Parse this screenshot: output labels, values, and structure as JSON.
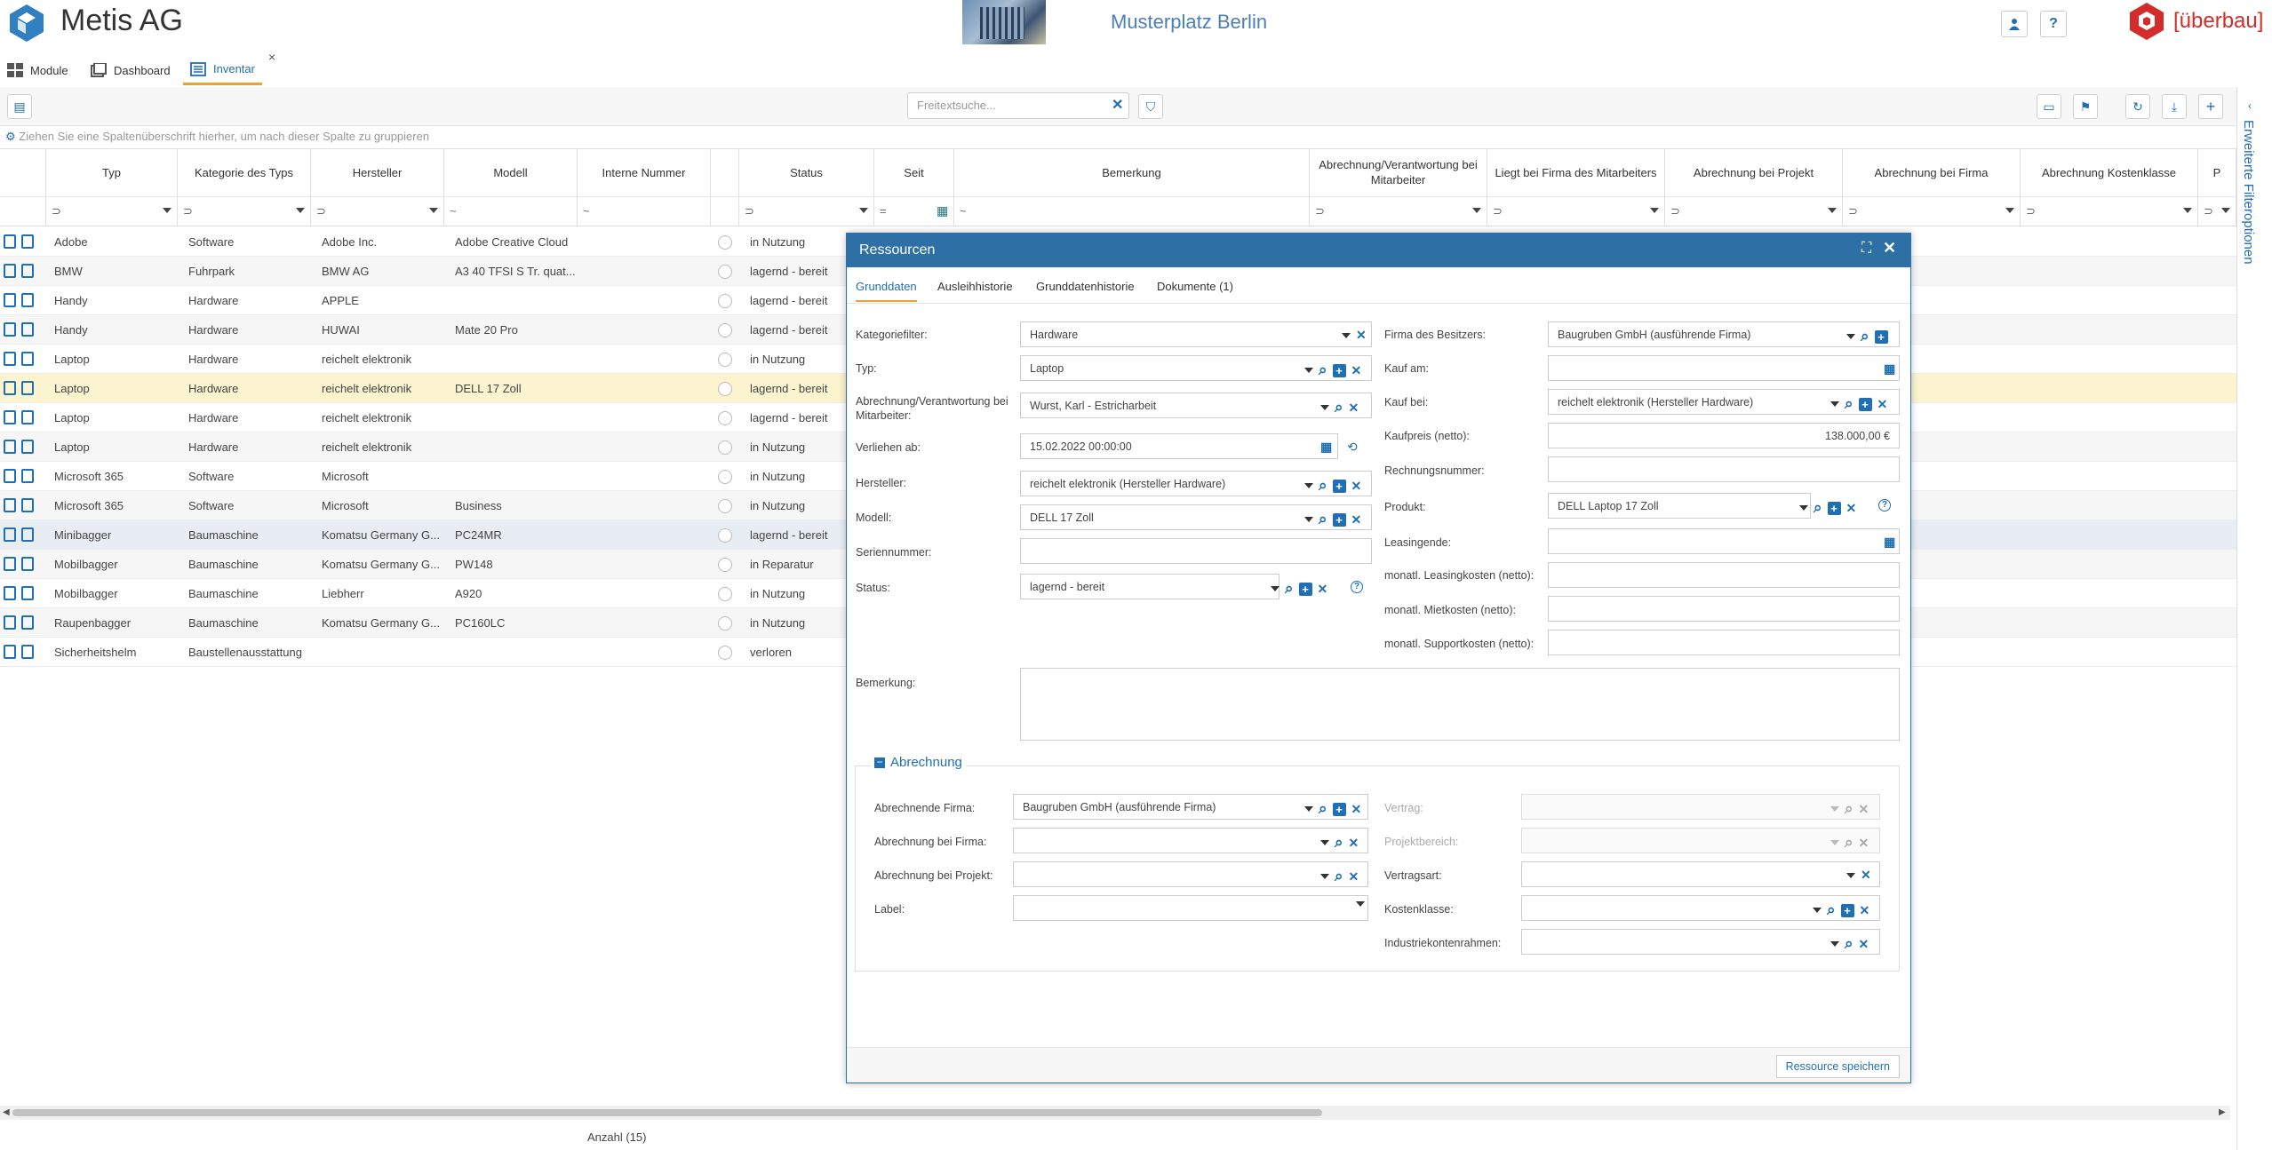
{
  "app": {
    "title": "Metis AG",
    "location": "Musterplatz Berlin",
    "brand": "überbau"
  },
  "tabs": [
    {
      "label": "Module"
    },
    {
      "label": "Dashboard"
    },
    {
      "label": "Inventar"
    }
  ],
  "toolbar": {
    "search_placeholder": "Freitextsuche..."
  },
  "group_hint": "Ziehen Sie eine Spaltenüberschrift hierher, um nach dieser Spalte zu gruppieren",
  "columns": [
    "Typ",
    "Kategorie des Typs",
    "Hersteller",
    "Modell",
    "Interne Nummer",
    "Status",
    "Seit",
    "Bemerkung",
    "Abrechnung/Verantwortung bei Mitarbeiter",
    "Liegt bei Firma des Mitarbeiters",
    "Abrechnung bei Projekt",
    "Abrechnung bei Firma",
    "Abrechnung Kostenklasse",
    "P"
  ],
  "rows": [
    {
      "typ": "Adobe",
      "kat": "Software",
      "her": "Adobe Inc.",
      "mod": "Adobe Creative Cloud",
      "status": "in Nutzung"
    },
    {
      "typ": "BMW",
      "kat": "Fuhrpark",
      "her": "BMW AG",
      "mod": "A3 40 TFSI S Tr. quat...",
      "status": "lagernd - bereit"
    },
    {
      "typ": "Handy",
      "kat": "Hardware",
      "her": "APPLE",
      "mod": "",
      "status": "lagernd - bereit"
    },
    {
      "typ": "Handy",
      "kat": "Hardware",
      "her": "HUWAI",
      "mod": "Mate 20 Pro",
      "status": "lagernd - bereit"
    },
    {
      "typ": "Laptop",
      "kat": "Hardware",
      "her": "reichelt elektronik",
      "mod": "",
      "status": "in Nutzung"
    },
    {
      "typ": "Laptop",
      "kat": "Hardware",
      "her": "reichelt elektronik",
      "mod": "DELL 17 Zoll",
      "status": "lagernd - bereit"
    },
    {
      "typ": "Laptop",
      "kat": "Hardware",
      "her": "reichelt elektronik",
      "mod": "",
      "status": "lagernd - bereit"
    },
    {
      "typ": "Laptop",
      "kat": "Hardware",
      "her": "reichelt elektronik",
      "mod": "",
      "status": "in Nutzung"
    },
    {
      "typ": "Microsoft 365",
      "kat": "Software",
      "her": "Microsoft",
      "mod": "",
      "status": "in Nutzung"
    },
    {
      "typ": "Microsoft 365",
      "kat": "Software",
      "her": "Microsoft",
      "mod": "Business",
      "status": "in Nutzung"
    },
    {
      "typ": "Minibagger",
      "kat": "Baumaschine",
      "her": "Komatsu Germany G...",
      "mod": "PC24MR",
      "status": "lagernd - bereit"
    },
    {
      "typ": "Mobilbagger",
      "kat": "Baumaschine",
      "her": "Komatsu Germany G...",
      "mod": "PW148",
      "status": "in Reparatur"
    },
    {
      "typ": "Mobilbagger",
      "kat": "Baumaschine",
      "her": "Liebherr",
      "mod": "A920",
      "status": "in Nutzung"
    },
    {
      "typ": "Raupenbagger",
      "kat": "Baumaschine",
      "her": "Komatsu Germany G...",
      "mod": "PC160LC",
      "status": "in Nutzung"
    },
    {
      "typ": "Sicherheitshelm",
      "kat": "Baustellenausstattung",
      "her": "",
      "mod": "",
      "status": "verloren"
    }
  ],
  "footer": {
    "count": "Anzahl (15)"
  },
  "side_panel": {
    "label": "Erweiterte Filteroptionen"
  },
  "modal": {
    "title": "Ressourcen",
    "tabs": [
      "Grunddaten",
      "Ausleihhistorie",
      "Grunddatenhistorie",
      "Dokumente (1)"
    ],
    "left": {
      "kategoriefilter": {
        "label": "Kategoriefilter:",
        "value": "Hardware"
      },
      "typ": {
        "label": "Typ:",
        "value": "Laptop"
      },
      "mitarbeiter": {
        "label": "Abrechnung/Verantwortung bei Mitarbeiter:",
        "value": "Wurst, Karl - Estricharbeit"
      },
      "verliehen": {
        "label": "Verliehen ab:",
        "value": "15.02.2022 00:00:00"
      },
      "hersteller": {
        "label": "Hersteller:",
        "value": "reichelt elektronik  (Hersteller Hardware)"
      },
      "modell": {
        "label": "Modell:",
        "value": "DELL 17 Zoll"
      },
      "seriennummer": {
        "label": "Seriennummer:",
        "value": ""
      },
      "status": {
        "label": "Status:",
        "value": "lagernd - bereit"
      }
    },
    "right": {
      "firma": {
        "label": "Firma des Besitzers:",
        "value": "Baugruben GmbH (ausführende Firma)"
      },
      "kauf_am": {
        "label": "Kauf am:",
        "value": ""
      },
      "kauf_bei": {
        "label": "Kauf bei:",
        "value": "reichelt elektronik  (Hersteller Hardware)"
      },
      "kaufpreis": {
        "label": "Kaufpreis (netto):",
        "value": "138.000,00 €"
      },
      "rechnungsnummer": {
        "label": "Rechnungsnummer:",
        "value": ""
      },
      "produkt": {
        "label": "Produkt:",
        "value": "DELL Laptop 17 Zoll"
      },
      "leasingende": {
        "label": "Leasingende:",
        "value": ""
      },
      "leasingkosten": {
        "label": "monatl. Leasingkosten (netto):",
        "value": ""
      },
      "mietkosten": {
        "label": "monatl. Mietkosten (netto):",
        "value": ""
      },
      "supportkosten": {
        "label": "monatl. Supportkosten (netto):",
        "value": ""
      }
    },
    "bemerkung": {
      "label": "Bemerkung:",
      "value": ""
    },
    "abrechnung": {
      "legend": "Abrechnung",
      "firma": {
        "label": "Abrechnende Firma:",
        "value": "Baugruben GmbH (ausführende Firma)"
      },
      "bei_firma": {
        "label": "Abrechnung bei Firma:",
        "value": ""
      },
      "bei_projekt": {
        "label": "Abrechnung bei Projekt:",
        "value": ""
      },
      "label": {
        "label": "Label:",
        "value": ""
      },
      "vertrag": {
        "label": "Vertrag:",
        "value": ""
      },
      "projektbereich": {
        "label": "Projektbereich:",
        "value": ""
      },
      "vertragsart": {
        "label": "Vertragsart:",
        "value": ""
      },
      "kostenklasse": {
        "label": "Kostenklasse:",
        "value": ""
      },
      "industriekontenrahmen": {
        "label": "Industriekontenrahmen:",
        "value": ""
      }
    },
    "save_label": "Ressource speichern"
  }
}
